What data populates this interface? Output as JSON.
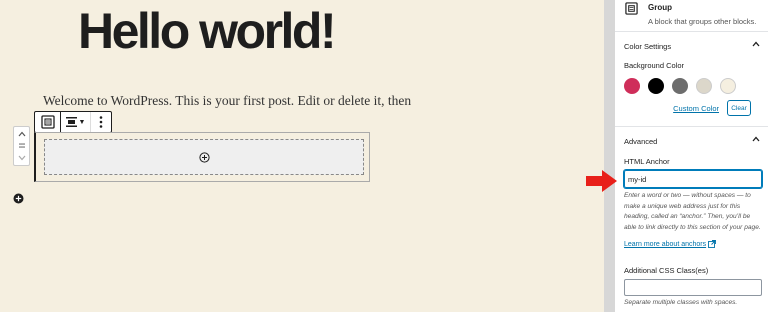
{
  "editor": {
    "title": "Hello world!",
    "paragraph": "Welcome to WordPress. This is your first post. Edit or delete it, then"
  },
  "sidebar": {
    "block_card": {
      "name": "Group",
      "description": "A block that groups other blocks."
    },
    "color_settings": {
      "heading": "Color Settings",
      "background_label": "Background Color",
      "swatches": [
        "#cf2e5a",
        "#000000",
        "#6d6d6d",
        "#dcd7ca",
        "#f5efe0"
      ],
      "custom_color_link": "Custom Color",
      "clear_button": "Clear"
    },
    "advanced": {
      "heading": "Advanced",
      "html_anchor_label": "HTML Anchor",
      "html_anchor_value": "my-id",
      "html_anchor_help": "Enter a word or two — without spaces — to make a unique web address just for this heading, called an “anchor.” Then, you’ll be able to link directly to this section of your page.",
      "learn_more_link": "Learn more about anchors",
      "css_class_label": "Additional CSS Class(es)",
      "css_class_value": "",
      "css_class_help": "Separate multiple classes with spaces."
    }
  },
  "colors": {
    "accent": "#007cba",
    "link": "#0073aa",
    "canvas_bg": "#f5efe0",
    "arrow": "#e8201a"
  }
}
